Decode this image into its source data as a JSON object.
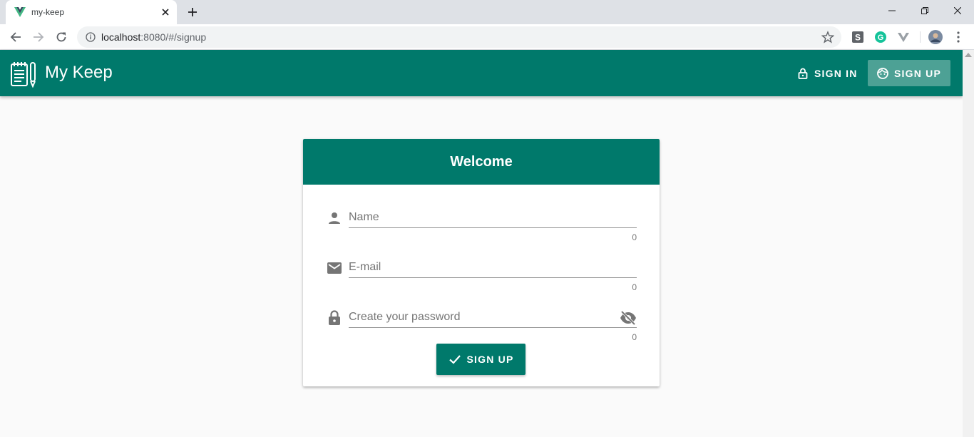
{
  "browser": {
    "tab_title": "my-keep",
    "url_host": "localhost",
    "url_rest": ":8080/#/signup"
  },
  "app": {
    "title": "My Keep",
    "nav": {
      "signin_label": "SIGN IN",
      "signup_label": "SIGN UP"
    }
  },
  "form": {
    "header": "Welcome",
    "fields": [
      {
        "placeholder": "Name",
        "value": "",
        "counter": "0",
        "icon": "person-icon"
      },
      {
        "placeholder": "E-mail",
        "value": "",
        "counter": "0",
        "icon": "email-icon"
      },
      {
        "placeholder": "Create your password",
        "value": "",
        "counter": "0",
        "icon": "lock-icon"
      }
    ],
    "submit_label": "SIGN UP"
  },
  "colors": {
    "primary": "#00796b",
    "signup_nav_bg": "#4da195",
    "page_bg": "#fafafa"
  }
}
